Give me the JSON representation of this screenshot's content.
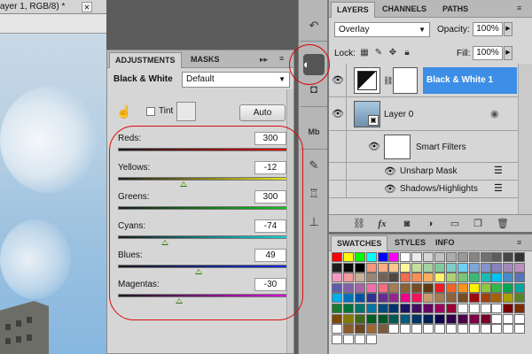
{
  "document": {
    "tab_title": "ayer 1, RGB/8) *",
    "close_glyph": "✕"
  },
  "adjustments": {
    "tabs": [
      {
        "label": "ADJUSTMENTS",
        "active": true
      },
      {
        "label": "MASKS",
        "active": false
      }
    ],
    "title": "Black & White",
    "preset": "Default",
    "tint_label": "Tint",
    "tint_checked": false,
    "auto_label": "Auto",
    "sliders": [
      {
        "label": "Reds:",
        "value": "300",
        "position": 1.0,
        "gradient": [
          "#1a1a1a",
          "#e01010"
        ]
      },
      {
        "label": "Yellows:",
        "value": "-12",
        "position": 0.37,
        "gradient": [
          "#1a1a1a",
          "#f0e818"
        ]
      },
      {
        "label": "Greens:",
        "value": "300",
        "position": 1.0,
        "gradient": [
          "#1a1a1a",
          "#10c818"
        ]
      },
      {
        "label": "Cyans:",
        "value": "-74",
        "position": 0.26,
        "gradient": [
          "#1a1a1a",
          "#10d8e0"
        ]
      },
      {
        "label": "Blues:",
        "value": "49",
        "position": 0.46,
        "gradient": [
          "#1a1a1a",
          "#1028e0"
        ]
      },
      {
        "label": "Magentas:",
        "value": "-30",
        "position": 0.34,
        "gradient": [
          "#1a1a1a",
          "#e010e0"
        ]
      }
    ]
  },
  "layers": {
    "tabs": [
      {
        "label": "LAYERS",
        "active": true
      },
      {
        "label": "CHANNELS",
        "active": false
      },
      {
        "label": "PATHS",
        "active": false
      }
    ],
    "blend_mode": "Overlay",
    "opacity_label": "Opacity:",
    "opacity_value": "100%",
    "lock_label": "Lock:",
    "fill_label": "Fill:",
    "fill_value": "100%",
    "rows": [
      {
        "name": "Black & White 1",
        "selected": true
      },
      {
        "name": "Layer 0",
        "selected": false
      },
      {
        "name": "Smart Filters",
        "selected": false
      },
      {
        "name": "Unsharp Mask",
        "selected": false
      },
      {
        "name": "Shadows/Highlights",
        "selected": false
      }
    ]
  },
  "swatches": {
    "tabs": [
      {
        "label": "SWATCHES",
        "active": true
      },
      {
        "label": "STYLES",
        "active": false
      },
      {
        "label": "INFO",
        "active": false
      }
    ],
    "colors": [
      "#ff0000",
      "#ffff00",
      "#00ff00",
      "#00ffff",
      "#0000ff",
      "#ff00ff",
      "#ffffff",
      "#ebebeb",
      "#d6d6d6",
      "#c2c2c2",
      "#adadad",
      "#999999",
      "#858585",
      "#707070",
      "#5c5c5c",
      "#474747",
      "#333333",
      "#1f1f1f",
      "#0a0a0a",
      "#000000",
      "#f7977a",
      "#f9ad81",
      "#fdc68a",
      "#fff79a",
      "#c4df9b",
      "#a2d39c",
      "#82ca9d",
      "#7bcdc8",
      "#6ecff6",
      "#7ea7d8",
      "#8493ca",
      "#8882be",
      "#a187be",
      "#bc8dbf",
      "#f49ac2",
      "#f6989d",
      "#c7b299",
      "#998675",
      "#736357",
      "#534741",
      "#f26c4f",
      "#f68e55",
      "#fbaf5c",
      "#fff467",
      "#acd372",
      "#7cc576",
      "#3bb878",
      "#1abbb4",
      "#00bff3",
      "#438cca",
      "#5574b9",
      "#605ca8",
      "#855fa8",
      "#a763a8",
      "#f06ea9",
      "#f26d7d",
      "#a67c52",
      "#8c6239",
      "#754c24",
      "#603913",
      "#ed1c24",
      "#f26522",
      "#f7941d",
      "#fff200",
      "#8dc73f",
      "#39b54a",
      "#00a651",
      "#00a99d",
      "#00aeef",
      "#0072bc",
      "#0054a6",
      "#2e3192",
      "#662d91",
      "#92278f",
      "#ec008c",
      "#ed145b",
      "#c69c6d",
      "#a67c52",
      "#8c6239",
      "#754c24",
      "#9e0b0f",
      "#a0410d",
      "#a36209",
      "#aba000",
      "#598527",
      "#1a7b30",
      "#007236",
      "#00746b",
      "#0076a3",
      "#004b80",
      "#003471",
      "#1b1464",
      "#440e62",
      "#630460",
      "#9e005d",
      "#9e0039",
      "#ffffff",
      "#ffffff",
      "#ffffff",
      "#ffffff",
      "#790000",
      "#7b2e00",
      "#7d4900",
      "#827b00",
      "#406618",
      "#005e20",
      "#005826",
      "#005952",
      "#005b7f",
      "#003663",
      "#002157",
      "#0d004c",
      "#32004b",
      "#4b0049",
      "#7b0046",
      "#7a0026",
      "#ffffff",
      "#ffffff",
      "#ffffff",
      "#ffffff",
      "#8a5a2b",
      "#6b4420",
      "#a06830",
      "#7c5a3a",
      "#ffffff",
      "#ffffff",
      "#ffffff",
      "#ffffff",
      "#ffffff",
      "#ffffff",
      "#ffffff",
      "#ffffff",
      "#ffffff",
      "#ffffff",
      "#ffffff",
      "#ffffff",
      "#ffffff",
      "#ffffff",
      "#ffffff",
      "#ffffff"
    ]
  },
  "annotation_color": "#d80b0b"
}
